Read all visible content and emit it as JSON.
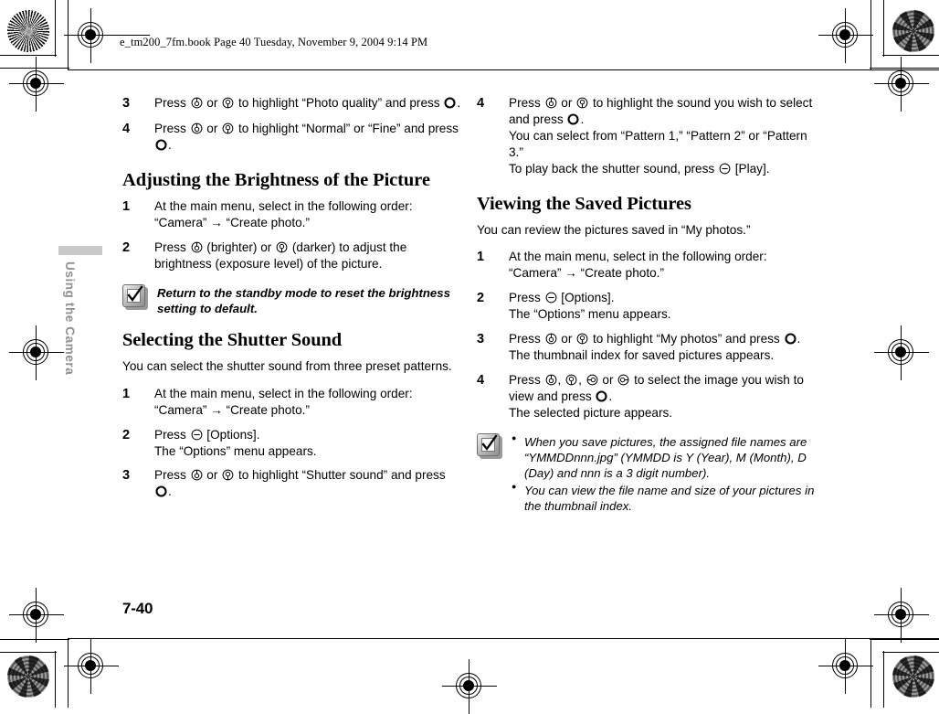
{
  "header": {
    "text": "e_tm200_7fm.book  Page 40  Tuesday, November 9, 2004  9:14 PM"
  },
  "sidebar": {
    "chapter_label": "Using the Camera"
  },
  "footer": {
    "page_number": "7-40"
  },
  "icons": {
    "up_key": "up-key-icon",
    "down_key": "down-key-icon",
    "left_key": "left-key-icon",
    "right_key": "right-key-icon",
    "center_key": "center-select-key-icon",
    "softkey": "left-softkey-icon",
    "note": "note-checkmark-icon"
  },
  "left_column": {
    "steps_top": [
      {
        "num": "3",
        "parts": [
          "Press ",
          "KEY_UP",
          " or ",
          "KEY_DOWN",
          " to highlight “Photo quality” and press ",
          "KEY_CENTER",
          "."
        ]
      },
      {
        "num": "4",
        "parts": [
          "Press ",
          "KEY_UP",
          " or ",
          "KEY_DOWN",
          " to highlight “Normal” or “Fine” and press ",
          "KEY_CENTER",
          "."
        ]
      }
    ],
    "section_brightness": {
      "title": "Adjusting the Brightness of the Picture",
      "steps": [
        {
          "num": "1",
          "parts": [
            "At the main menu, select in the following order: “Camera” → “Create photo.”"
          ]
        },
        {
          "num": "2",
          "parts": [
            "Press ",
            "KEY_UP",
            " (brighter) or ",
            "KEY_DOWN",
            " (darker) to adjust the brightness (exposure level) of the picture."
          ]
        }
      ],
      "note": "Return to the standby mode to reset the brightness setting to default."
    },
    "section_shutter": {
      "title": "Selecting the Shutter Sound",
      "intro": "You can select the shutter sound from three preset patterns.",
      "steps": [
        {
          "num": "1",
          "parts": [
            "At the main menu, select in the following order: “Camera” → “Create photo.”"
          ]
        },
        {
          "num": "2",
          "parts": [
            "Press ",
            "KEY_SOFT",
            " [Options]."
          ],
          "sub": "The “Options” menu appears."
        },
        {
          "num": "3",
          "parts": [
            "Press ",
            "KEY_UP",
            " or ",
            "KEY_DOWN",
            " to highlight “Shutter sound” and press ",
            "KEY_CENTER",
            "."
          ]
        }
      ]
    }
  },
  "right_column": {
    "step_top": {
      "num": "4",
      "parts": [
        "Press ",
        "KEY_UP",
        " or ",
        "KEY_DOWN",
        " to highlight the sound you wish to select and press ",
        "KEY_CENTER",
        "."
      ],
      "sub1": "You can select from “Pattern 1,” “Pattern 2” or “Pattern 3.”",
      "sub2_parts": [
        "To play back the shutter sound, press ",
        "KEY_SOFT",
        " [Play]."
      ]
    },
    "section_viewing": {
      "title": "Viewing the Saved Pictures",
      "intro": "You can review the pictures saved in “My photos.”",
      "steps": [
        {
          "num": "1",
          "parts": [
            "At the main menu, select in the following order: “Camera” → “Create photo.”"
          ]
        },
        {
          "num": "2",
          "parts": [
            "Press ",
            "KEY_SOFT",
            " [Options]."
          ],
          "sub": "The “Options” menu appears."
        },
        {
          "num": "3",
          "parts": [
            "Press ",
            "KEY_UP",
            " or ",
            "KEY_DOWN",
            " to highlight “My photos” and press ",
            "KEY_CENTER",
            "."
          ],
          "sub": "The thumbnail index for saved pictures appears."
        },
        {
          "num": "4",
          "parts": [
            "Press ",
            "KEY_UP",
            ", ",
            "KEY_DOWN",
            ", ",
            "KEY_LEFT",
            " or ",
            "KEY_RIGHT",
            " to select the image you wish to view and press ",
            "KEY_CENTER",
            "."
          ],
          "sub": "The selected picture appears."
        }
      ],
      "notes": [
        "When you save pictures, the assigned file names are “YMMDDnnn.jpg” (YMMDD is Y (Year), M (Month), D (Day) and nnn is a 3 digit number).",
        "You can view the file name and size of your pictures in the thumbnail index."
      ]
    }
  }
}
